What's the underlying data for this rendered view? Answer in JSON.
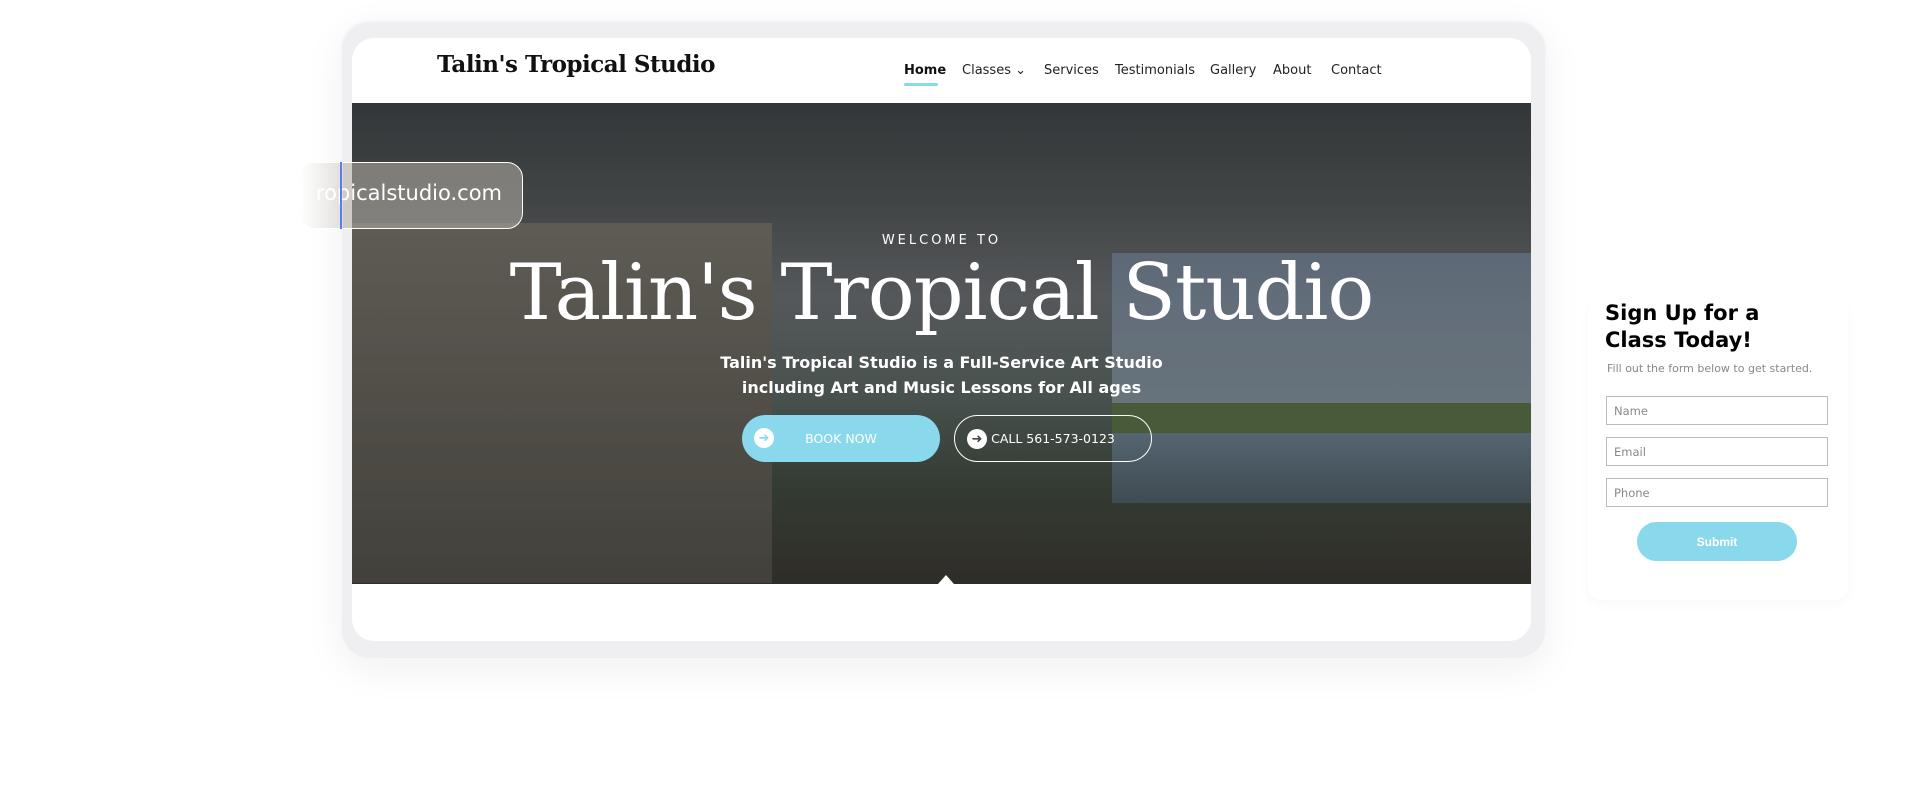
{
  "site": {
    "logo": "Talin's Tropical Studio"
  },
  "nav": {
    "items": [
      {
        "label": "Home",
        "active": true
      },
      {
        "label": "Classes ⌄"
      },
      {
        "label": "Services"
      },
      {
        "label": "Testimonials"
      },
      {
        "label": "Gallery"
      },
      {
        "label": "About"
      },
      {
        "label": "Contact"
      }
    ]
  },
  "hero": {
    "eyebrow": "WELCOME TO",
    "title": "Talin's  Tropical Studio",
    "subtitle_line1": "Talin's Tropical Studio is a Full-Service Art Studio",
    "subtitle_line2": "including Art and Music Lessons for All ages",
    "book_label": "BOOK NOW",
    "call_label": "CALL 561-573-0123",
    "button_icon": "arrow-circle-right-icon"
  },
  "url_pill": {
    "text": "ropicalstudio.com"
  },
  "form": {
    "heading_line1": "Sign Up for a",
    "heading_line2": "Class Today!",
    "subtitle": "Fill out the form below to get started.",
    "name_placeholder": "Name",
    "email_placeholder": "Email",
    "phone_placeholder": "Phone",
    "submit_label": "Submit"
  },
  "colors": {
    "accent": "#8ad8ec",
    "frame": "#efeff2"
  }
}
